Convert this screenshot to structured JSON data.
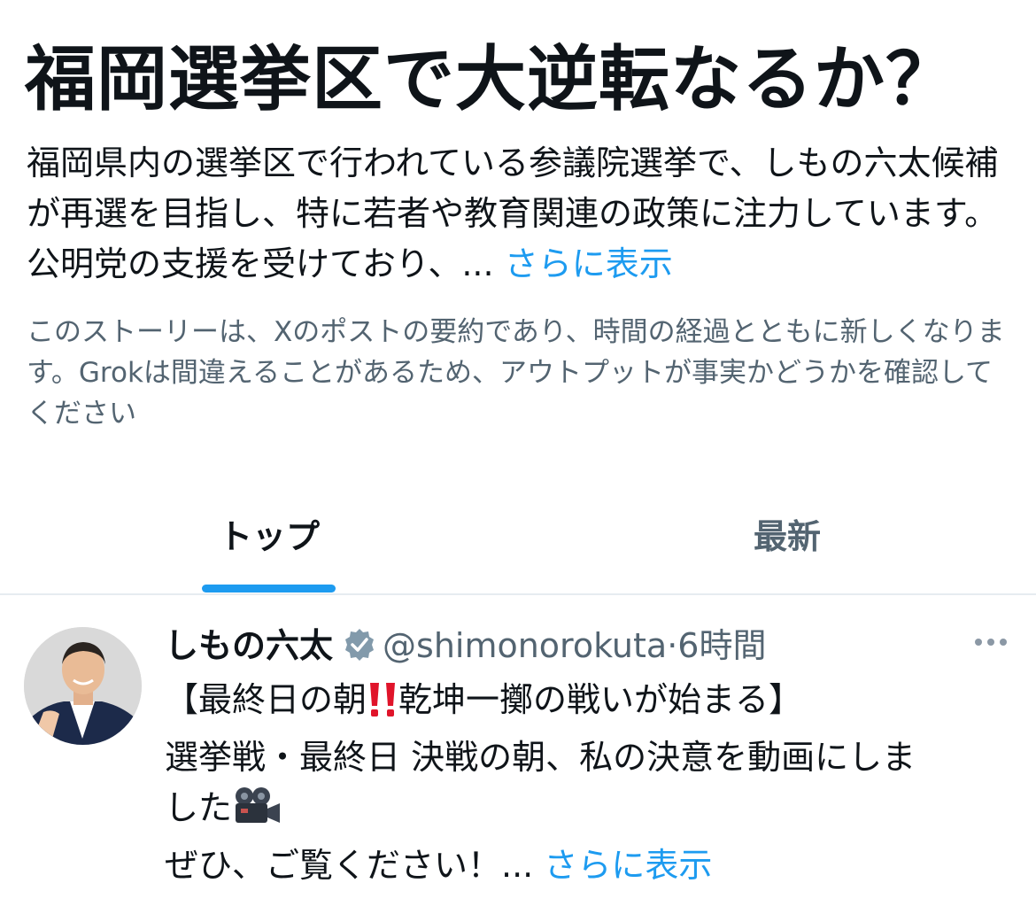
{
  "story": {
    "title": "福岡選挙区で大逆転なるか？",
    "summary": "福岡県内の選挙区で行われている参議院選挙で、しもの六太候補が再選を目指し、特に若者や教育関連の政策に注力しています。公明党の支援を受けており、...",
    "show_more": "さらに表示",
    "disclaimer": "このストーリーは、Xのポストの要約であり、時間の経過とともに新しくなります。Grokは間違えることがあるため、アウトプットが事実かどうかを確認してください"
  },
  "tabs": {
    "top": "トップ",
    "latest": "最新",
    "active": "top"
  },
  "post": {
    "author_name": "しもの六太",
    "handle": "@shimonorokuta",
    "separator": "·",
    "time": "6時間",
    "line1_a": "【最終日の朝",
    "line1_b": "乾坤一擲の戦いが始まる】",
    "line2": "選挙戦・最終日 決戦の朝、私の決意を動画にしま",
    "line3": "した",
    "line4": "ぜひ、ご覧ください！...",
    "show_more": "さらに表示",
    "icons": {
      "verified": "verified-badge-icon",
      "alert": "double-exclamation-icon",
      "camera": "movie-camera-icon",
      "more": "more-options-icon"
    }
  },
  "colors": {
    "accent": "#1d9bf0",
    "text": "#0f1419",
    "secondary": "#536471",
    "alert": "#e0142a"
  }
}
